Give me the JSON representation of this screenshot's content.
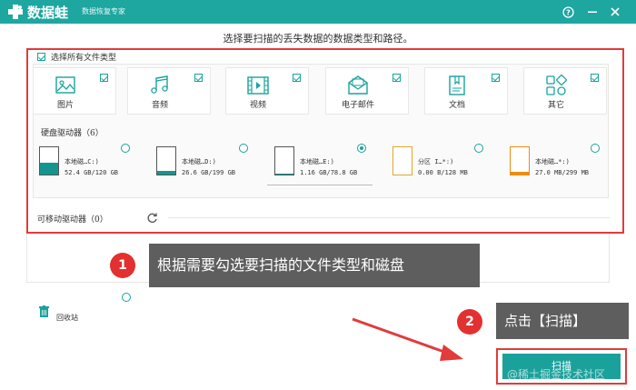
{
  "app": {
    "name": "数据蛙",
    "subtitle": "数据恢复专家",
    "controls": [
      "help-icon",
      "minimize-icon",
      "close-icon"
    ]
  },
  "instruction": "选择要扫描的丢失数据的数据类型和路径。",
  "file_types": {
    "select_all_label": "选择所有文件类型",
    "items": [
      {
        "label": "图片",
        "icon": "image-icon",
        "checked": true
      },
      {
        "label": "音频",
        "icon": "music-icon",
        "checked": true
      },
      {
        "label": "视频",
        "icon": "video-icon",
        "checked": true
      },
      {
        "label": "电子邮件",
        "icon": "mail-icon",
        "checked": true
      },
      {
        "label": "文档",
        "icon": "document-icon",
        "checked": true
      },
      {
        "label": "其它",
        "icon": "other-icon",
        "checked": true
      }
    ]
  },
  "hard_drives": {
    "title": "硬盘驱动器（6）",
    "items": [
      {
        "name": "本地磁…C:)",
        "size": "52.4 GB/120 GB",
        "fill": 0.44,
        "selected": false,
        "accent": "#13968f"
      },
      {
        "name": "本地磁…D:)",
        "size": "26.6 GB/199 GB",
        "fill": 0.13,
        "selected": false,
        "accent": "#13968f"
      },
      {
        "name": "本地磁…E:)",
        "size": "1.16 GB/78.8 GB",
        "fill": 0.02,
        "selected": true,
        "accent": "#13968f"
      },
      {
        "name": "分区 I…*:)",
        "size": "0.00  B/128 MB",
        "fill": 0.0,
        "selected": false,
        "accent": "#e0a82a"
      },
      {
        "name": "本地磁…*:)",
        "size": "27.0 MB/299 MB",
        "fill": 0.09,
        "selected": false,
        "accent": "#f08a12"
      }
    ]
  },
  "removable": {
    "title": "可移动驱动器（0）"
  },
  "recycle_bin": {
    "label": "回收站"
  },
  "callouts": {
    "step1_number": "1",
    "step1_text": "根据需要勾选要扫描的文件类型和磁盘",
    "step2_number": "2",
    "step2_text": "点击【扫描】"
  },
  "scan_button": {
    "label": "扫描"
  },
  "watermark": "@稀土掘金技术社区",
  "colors": {
    "brand": "#1ea6a0",
    "highlight": "#e23b3b",
    "callout_bg": "#5e5e5e",
    "badge": "#e33030"
  }
}
